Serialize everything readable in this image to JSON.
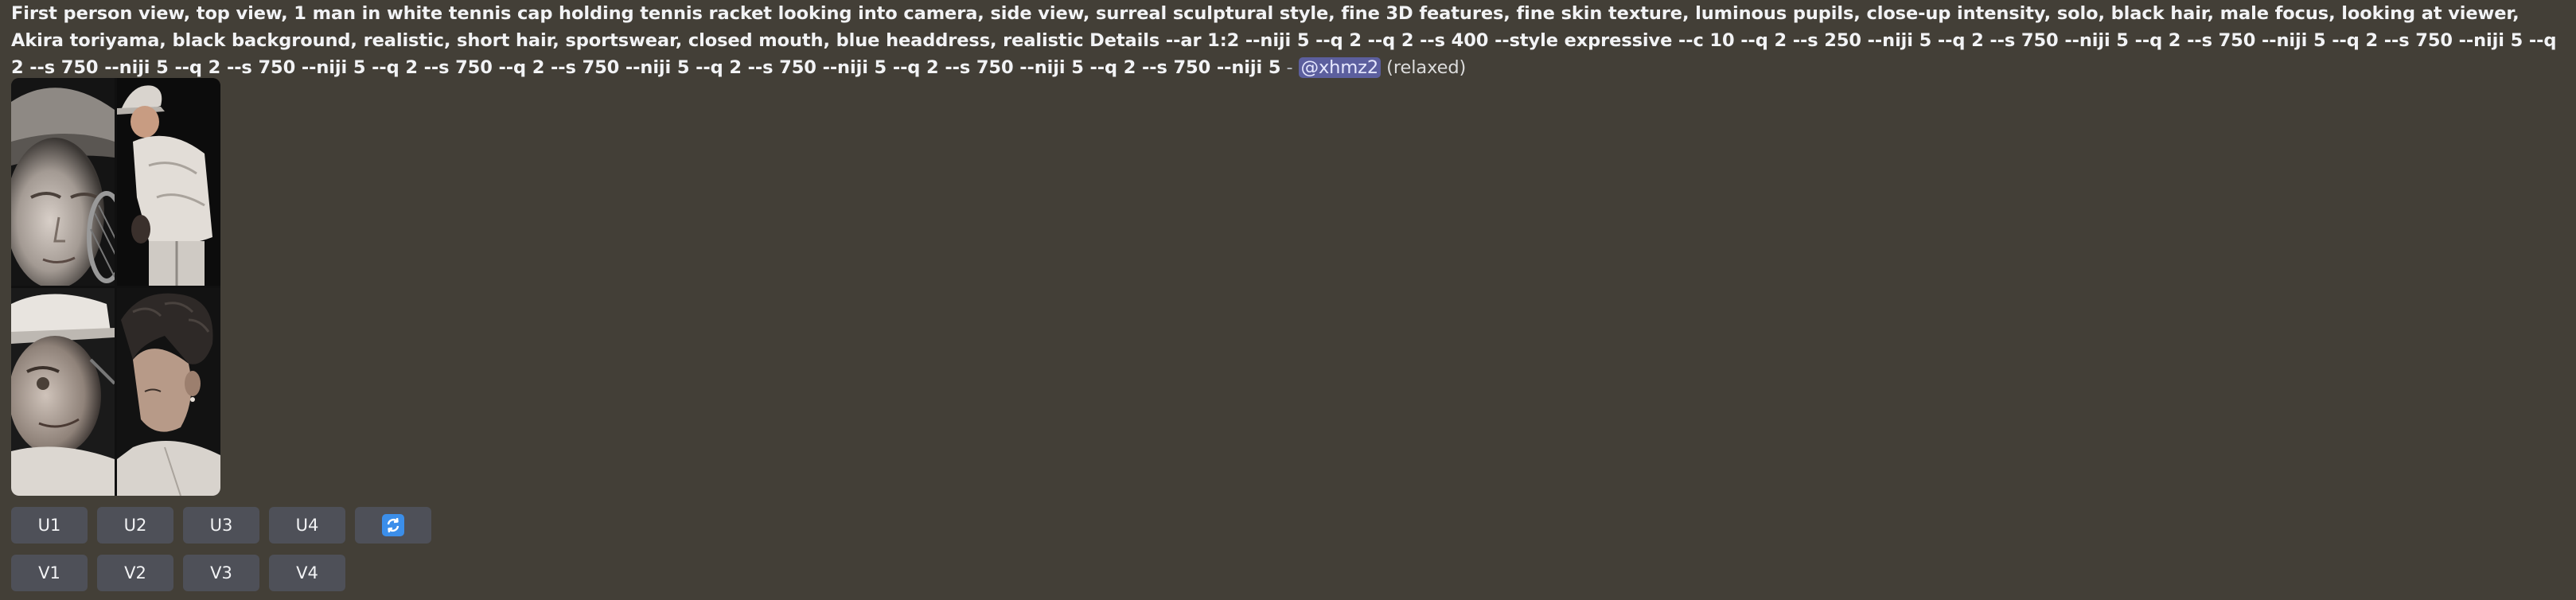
{
  "message": {
    "prompt": "First person view, top view, 1 man in white tennis cap holding tennis racket looking into camera, side view, surreal sculptural style, fine 3D features, fine skin texture, luminous pupils, close-up intensity, solo, black hair, male focus, looking at viewer, Akira toriyama, black background, realistic, short hair, sportswear, closed mouth, blue headdress, realistic Details --ar 1:2 --niji 5 --q 2 --q 2 --s 400 --style expressive --c 10 --q 2 --s 250 --niji 5 --q 2 --s 750 --niji 5 --q 2 --s 750 --niji 5 --q 2 --s 750 --niji 5 --q 2 --s 750 --niji 5 --q 2 --s 750 --niji 5 --q 2 --s 750 --q 2 --s 750 --niji 5 --q 2 --s 750 --niji 5 --q 2 --s 750 --niji 5 --q 2 --s 750 --niji 5",
    "separator": " - ",
    "mention": "@xhmz2",
    "mode": "(relaxed)"
  },
  "image_grid": {
    "tiles": [
      "man in cap with racket close-up",
      "man in white sportswear from behind",
      "man in white cap side profile",
      "dark-haired young man profile"
    ]
  },
  "buttons": {
    "upscale": [
      "U1",
      "U2",
      "U3",
      "U4"
    ],
    "reroll_icon": "refresh-icon",
    "variation": [
      "V1",
      "V2",
      "V3",
      "V4"
    ]
  },
  "colors": {
    "background": "#433f37",
    "button": "#4e5058",
    "mention_bg": "#5c5f9e",
    "reroll_blue": "#3b8eea"
  }
}
